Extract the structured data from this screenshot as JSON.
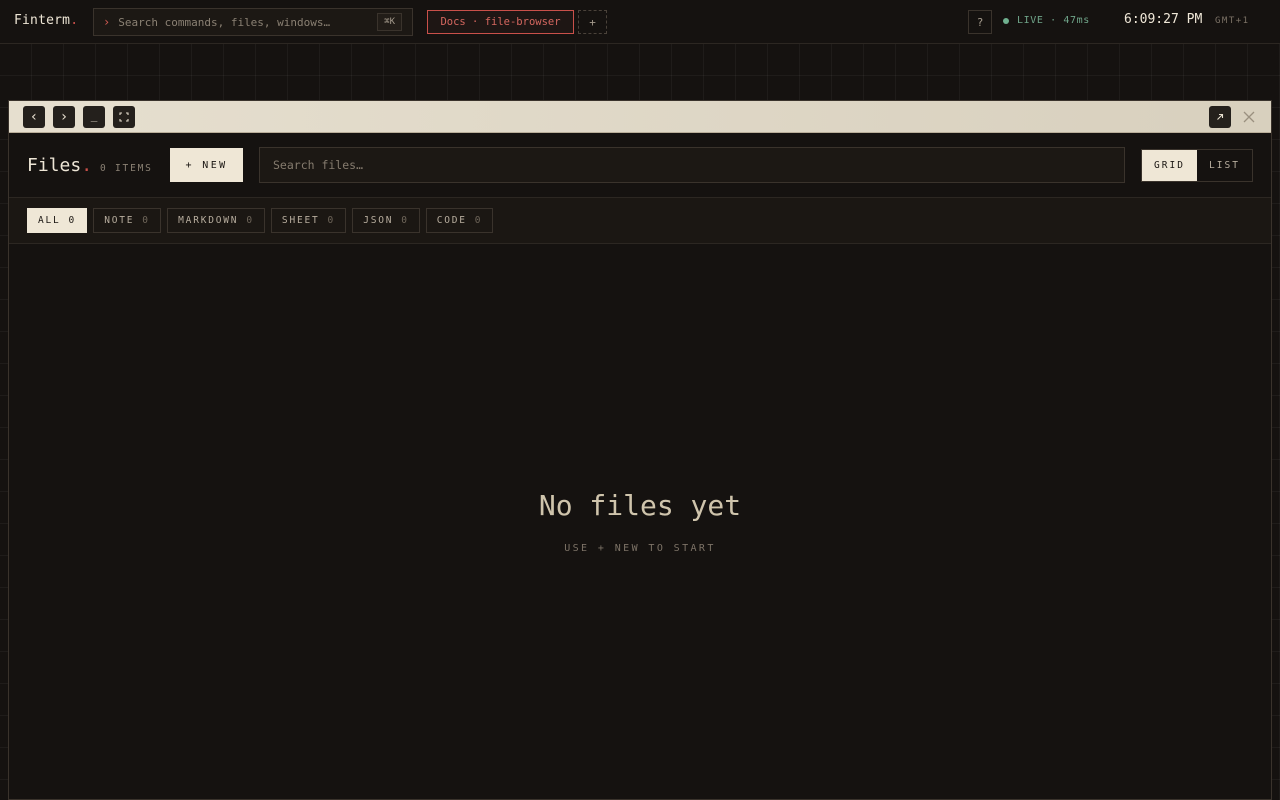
{
  "topbar": {
    "brand": "Finterm",
    "brand_dot": ".",
    "command": {
      "prompt": "›",
      "placeholder": "Search commands, files, windows…",
      "shortcut": "⌘K"
    },
    "active_tab": "Docs · file-browser",
    "add_tab": "+",
    "help": "?",
    "status": "LIVE · 47ms",
    "clock": "6:09:27 PM",
    "timezone": "GMT+1"
  },
  "window": {
    "controls": {
      "back": "‹",
      "forward": "›",
      "minimize": "_"
    },
    "title": "Files",
    "title_dot": ".",
    "count": "0 ITEMS",
    "new_label": "+ NEW",
    "search_placeholder": "Search files…",
    "views": [
      "GRID",
      "LIST"
    ],
    "active_view": "GRID",
    "filters": [
      {
        "label": "ALL",
        "count": "0",
        "active": true
      },
      {
        "label": "NOTE",
        "count": "0"
      },
      {
        "label": "MARKDOWN",
        "count": "0"
      },
      {
        "label": "SHEET",
        "count": "0"
      },
      {
        "label": "JSON",
        "count": "0"
      },
      {
        "label": "CODE",
        "count": "0"
      }
    ],
    "empty": {
      "title": "No files yet",
      "subtitle": "USE + NEW TO START"
    }
  },
  "colors": {
    "background": "#151210",
    "accent": "#c9504a",
    "live": "#6fb08f",
    "cream": "#efe7d6"
  }
}
